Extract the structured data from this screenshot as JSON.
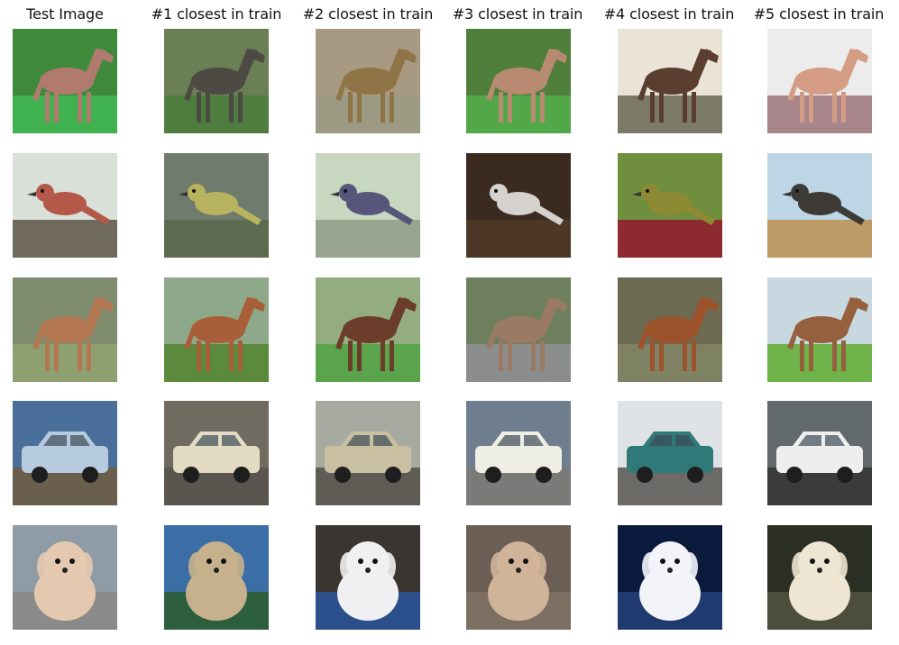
{
  "headers": [
    "Test Image",
    "#1 closest in train",
    "#2 closest in train",
    "#3 closest in train",
    "#4 closest in train",
    "#5 closest in train"
  ],
  "rows": [
    {
      "class": "horse",
      "cells": [
        {
          "bg": "#3f8a3a",
          "ground": "#3fb24f",
          "fg": "#b07a6e",
          "kind": "horse"
        },
        {
          "bg": "#6a7f53",
          "ground": "#4f7d3f",
          "fg": "#4d4a44",
          "kind": "horse"
        },
        {
          "bg": "#a89a82",
          "ground": "#9c9a83",
          "fg": "#8f7446",
          "kind": "horse"
        },
        {
          "bg": "#4f7f3b",
          "ground": "#52a849",
          "fg": "#b88a72",
          "kind": "horse"
        },
        {
          "bg": "#eae4d7",
          "ground": "#7b7a66",
          "fg": "#5a3e30",
          "kind": "horse"
        },
        {
          "bg": "#ececec",
          "ground": "#a7858a",
          "fg": "#d59c84",
          "kind": "horse"
        }
      ]
    },
    {
      "class": "bird",
      "cells": [
        {
          "bg": "#d9e0d7",
          "ground": "#6f6a5c",
          "fg": "#b4584a",
          "kind": "bird"
        },
        {
          "bg": "#6f7b6c",
          "ground": "#5c6b4f",
          "fg": "#b7b35e",
          "kind": "bird"
        },
        {
          "bg": "#c8d8c0",
          "ground": "#9aa58f",
          "fg": "#55567a",
          "kind": "bird"
        },
        {
          "bg": "#3a2a20",
          "ground": "#4d3827",
          "fg": "#d5d1cc",
          "kind": "bird"
        },
        {
          "bg": "#6f8f3e",
          "ground": "#8d2a2f",
          "fg": "#8e8a33",
          "kind": "bird"
        },
        {
          "bg": "#bcd6e6",
          "ground": "#bd9a66",
          "fg": "#3e3a36",
          "kind": "bird"
        }
      ]
    },
    {
      "class": "horse",
      "cells": [
        {
          "bg": "#7e8c6d",
          "ground": "#8ea06f",
          "fg": "#b37852",
          "kind": "horse"
        },
        {
          "bg": "#8ea88a",
          "ground": "#5b8a3c",
          "fg": "#a85f37",
          "kind": "horse"
        },
        {
          "bg": "#94ad80",
          "ground": "#5aa54b",
          "fg": "#6b3d2a",
          "kind": "horse"
        },
        {
          "bg": "#6d7f5d",
          "ground": "#8b8e8d",
          "fg": "#9b7a63",
          "kind": "horse"
        },
        {
          "bg": "#6d6a52",
          "ground": "#7f8163",
          "fg": "#9c532c",
          "kind": "horse"
        },
        {
          "bg": "#c9d8e0",
          "ground": "#6fb34a",
          "fg": "#94603e",
          "kind": "horse"
        }
      ]
    },
    {
      "class": "automobile",
      "cells": [
        {
          "bg": "#4a6f9a",
          "ground": "#6a5e4d",
          "fg": "#b6cbe0",
          "kind": "car"
        },
        {
          "bg": "#706b61",
          "ground": "#5b5550",
          "fg": "#e3dcc2",
          "kind": "car"
        },
        {
          "bg": "#a6aaa0",
          "ground": "#5f5b55",
          "fg": "#c9c0a2",
          "kind": "car"
        },
        {
          "bg": "#6f7e8f",
          "ground": "#7a7a78",
          "fg": "#efeee4",
          "kind": "car"
        },
        {
          "bg": "#dfe3e6",
          "ground": "#6b6a67",
          "fg": "#2f7a78",
          "kind": "car"
        },
        {
          "bg": "#636a6d",
          "ground": "#3b3b3b",
          "fg": "#eeeeee",
          "kind": "car"
        }
      ]
    },
    {
      "class": "dog",
      "cells": [
        {
          "bg": "#8f9ca6",
          "ground": "#8a8a8a",
          "fg": "#e4c9b0",
          "kind": "dog"
        },
        {
          "bg": "#3c6ea6",
          "ground": "#2d5f3e",
          "fg": "#c7b18c",
          "kind": "dog"
        },
        {
          "bg": "#3a3530",
          "ground": "#2a4f8a",
          "fg": "#f0f0f2",
          "kind": "dog"
        },
        {
          "bg": "#6a5e55",
          "ground": "#7d6e62",
          "fg": "#d0b49a",
          "kind": "dog"
        },
        {
          "bg": "#0b1a3c",
          "ground": "#1e3a6e",
          "fg": "#f2f4f8",
          "kind": "dog"
        },
        {
          "bg": "#2b2e22",
          "ground": "#4a4e3a",
          "fg": "#eee6d2",
          "kind": "dog"
        }
      ]
    }
  ]
}
